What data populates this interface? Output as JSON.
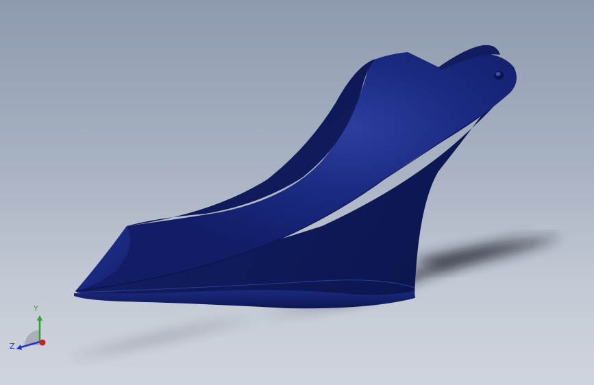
{
  "viewport": {
    "background_top": "#8e9aae",
    "background_bottom": "#cfd4dc"
  },
  "model": {
    "body_color": "#1a2a7a",
    "shadow_color": "#1c1f28"
  },
  "triad": {
    "x_label": "",
    "y_label": "Y",
    "z_label": "Z",
    "x_color": "#cc1f1f",
    "y_color": "#2aa52a",
    "z_color": "#2233cc"
  }
}
